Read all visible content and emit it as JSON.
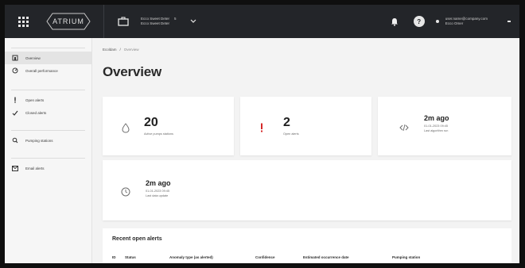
{
  "topbar": {
    "logo_text": "ATRIUM",
    "asset_name": "Ecco Sweet Deter",
    "asset_count": "5",
    "asset_sub": "Ecco Sweet Deter",
    "help_label": "?",
    "user_email": "user.name@company.com",
    "user_role": "Ecco Omer"
  },
  "sidebar": {
    "group_top": "",
    "items_main": [
      {
        "label": "Overview",
        "icon": "home-icon"
      },
      {
        "label": "Overall performance",
        "icon": "gauge-icon"
      }
    ],
    "group_alerts": "",
    "items_alerts": [
      {
        "label": "Open alerts",
        "icon": "exclamation-icon"
      },
      {
        "label": "Closed alerts",
        "icon": "check-icon"
      }
    ],
    "group_pumping": "",
    "items_pumping": [
      {
        "label": "Pumping stations",
        "icon": "search-icon"
      }
    ],
    "group_email": "",
    "items_email": [
      {
        "label": "Email alerts",
        "icon": "email-icon"
      }
    ]
  },
  "breadcrumb": {
    "root": "Ecoldam",
    "sep": "/",
    "current": "Overview"
  },
  "page": {
    "title": "Overview"
  },
  "cards": {
    "stations": {
      "value": "20",
      "label": "Active pumps stations"
    },
    "alerts": {
      "value": "2",
      "label": "Open alerts"
    },
    "sync": {
      "value": "2m ago",
      "date": "01-01-2023 09:45",
      "label": "Last algorithm run"
    },
    "update": {
      "value": "2m ago",
      "date": "01-01-2023 09:45",
      "label": "Last data update"
    }
  },
  "recent_alerts": {
    "title": "Recent open alerts",
    "columns": [
      "ID",
      "Status",
      "Anomaly type (as alerted)",
      "Confidence",
      "Estimated occurrence date",
      "Pumping station"
    ]
  },
  "colors": {
    "topbar_bg": "#232529",
    "alert_red": "#d62828",
    "page_bg": "#f3f3f3"
  }
}
